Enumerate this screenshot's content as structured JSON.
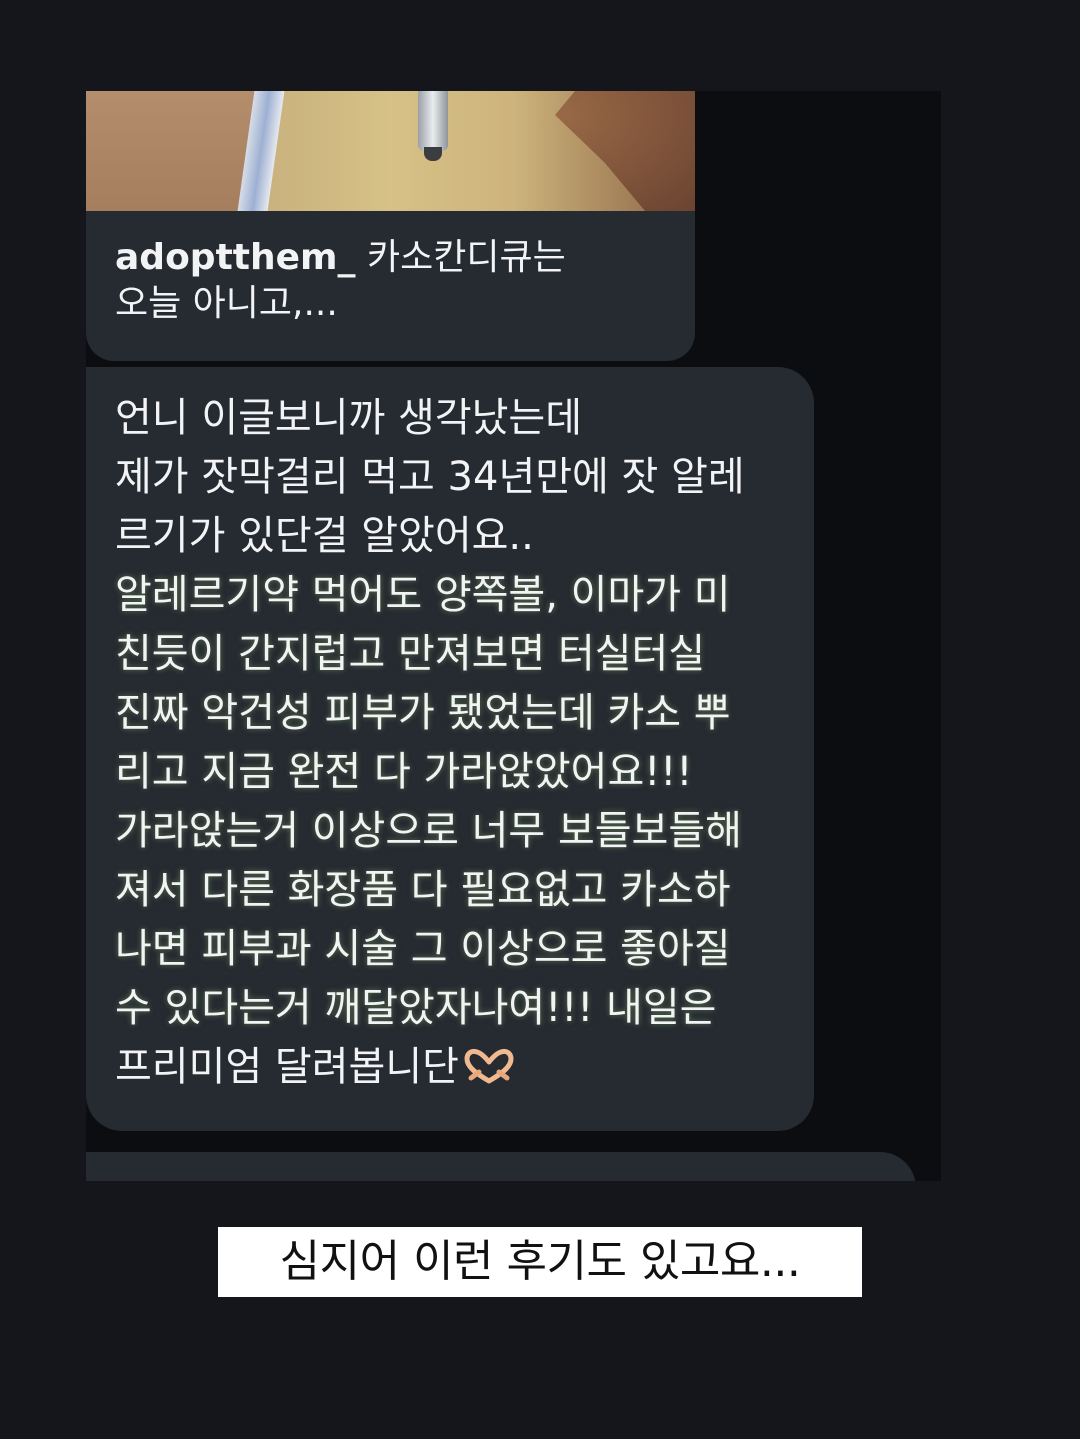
{
  "quote": {
    "username": "adoptthem_",
    "text_line1": " 카소칸디큐는",
    "text_line2": "오늘 아니고,..."
  },
  "message": {
    "lines": [
      "언니 이글보니까 생각났는데",
      "제가 잣막걸리 먹고 34년만에 잣 알레",
      "르기가 있단걸 알았어요..",
      "알레르기약 먹어도 양쪽볼, 이마가 미",
      "친듯이 간지럽고 만져보면 터실터실",
      "진짜 악건성 피부가 됐었는데 카소 뿌",
      "리고 지금 완전 다 가라앉았어요!!!",
      "가라앉는거 이상으로 너무 보들보들해",
      "져서 다른 화장품 다 필요없고 카소하",
      "나면 피부과 시술 그 이상으로 좋아질",
      "수 있다는거 깨달았자나여!!! 내일은",
      "프리미엄 달려봅니단"
    ],
    "end_icon": "heart-hands-icon"
  },
  "caption": {
    "text": "심지어 이런 후기도 있고요..."
  },
  "colors": {
    "background": "#14161b",
    "bubble": "#262a31",
    "text": "#f2f3f5",
    "caption_bg": "#ffffff"
  }
}
